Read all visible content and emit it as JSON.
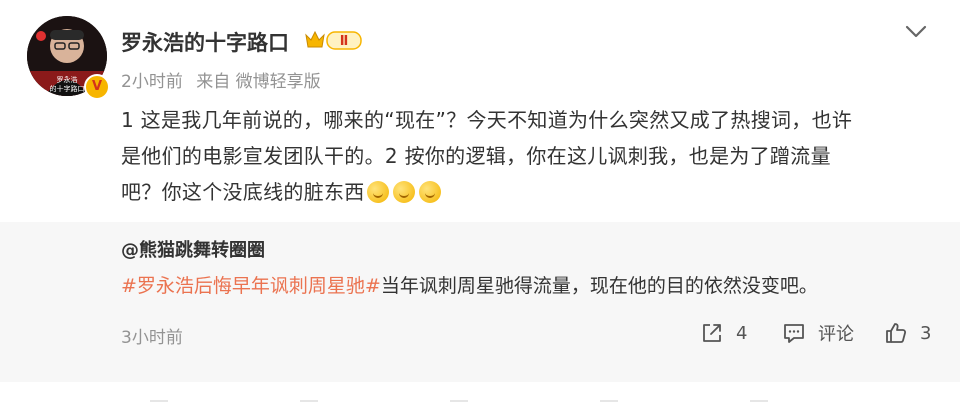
{
  "post": {
    "username": "罗永浩的十字路口",
    "vip_level": "Ⅱ",
    "time": "2小时前",
    "source": "来自 微博轻享版",
    "text_line1": "1 这是我几年前说的，哪来的“现在”？今天不知道为什么突然又成了热搜词，也许",
    "text_line2": "是他们的电影宣发团队干的。2 按你的逻辑，你在这儿讽刺我，也是为了蹭流量",
    "text_line3": "吧？你这个没底线的脏东西",
    "avatar_caption_1": "罗永浩",
    "avatar_caption_2": "的十字路口",
    "verified_mark": "V",
    "emojis": [
      "doge-emoji",
      "doge-emoji",
      "doge-emoji"
    ]
  },
  "repost": {
    "username": "@熊猫跳舞转圈圈",
    "hashtag": "#罗永浩后悔早年讽刺周星驰#",
    "text": "当年讽刺周星驰得流量，现在他的目的依然没变吧。",
    "time": "3小时前",
    "share_count": "4",
    "comment_label": "评论",
    "like_count": "3"
  },
  "colors": {
    "hashtag": "#eb7350",
    "meta": "#939393",
    "repost_bg": "#f7f7f7",
    "vip_gold": "#f7b500"
  }
}
